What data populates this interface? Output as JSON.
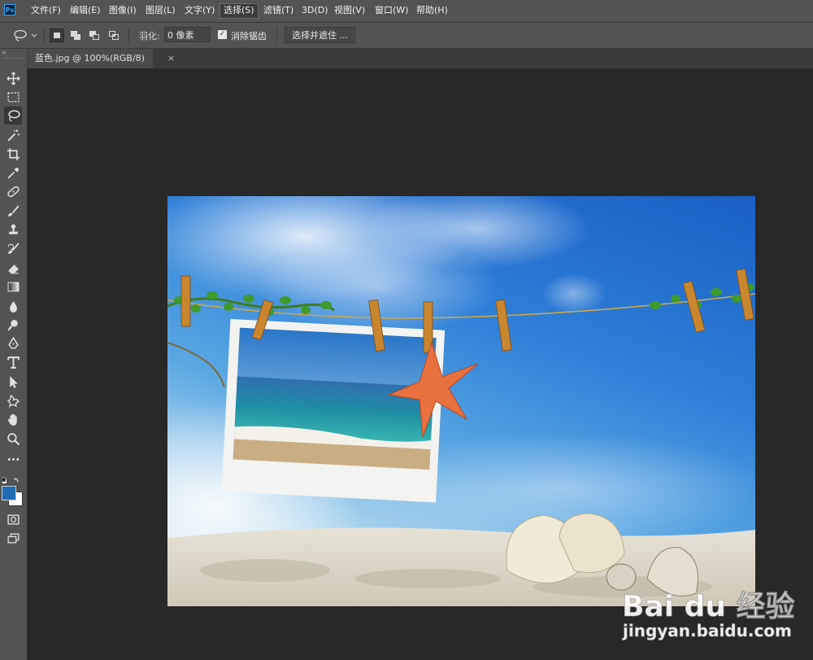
{
  "app": {
    "logo": "Ps",
    "brand_color": "#31a8ff"
  },
  "menu": [
    {
      "label": "文件(F)"
    },
    {
      "label": "编辑(E)"
    },
    {
      "label": "图像(I)"
    },
    {
      "label": "图层(L)"
    },
    {
      "label": "文字(Y)"
    },
    {
      "label": "选择(S)"
    },
    {
      "label": "滤镜(T)"
    },
    {
      "label": "3D(D)"
    },
    {
      "label": "视图(V)"
    },
    {
      "label": "窗口(W)"
    },
    {
      "label": "帮助(H)"
    }
  ],
  "options": {
    "tool_icon": "lasso-icon",
    "selection_modes": [
      "new-selection",
      "add-to-selection",
      "subtract-from-selection",
      "intersect-with-selection"
    ],
    "feather_label": "羽化:",
    "feather_value": "0 像素",
    "antialias_label": "消除锯齿",
    "antialias_checked": true,
    "select_and_mask_label": "选择并遮住 ..."
  },
  "document": {
    "tab_title": "蓝色.jpg @ 100%(RGB/8)",
    "close_glyph": "×"
  },
  "toolbar": {
    "collapse_glyph": "››",
    "tools": [
      "move-tool",
      "rectangular-marquee-tool",
      "lasso-tool",
      "magic-wand-tool",
      "crop-tool",
      "eyedropper-tool",
      "healing-brush-tool",
      "brush-tool",
      "clone-stamp-tool",
      "history-brush-tool",
      "eraser-tool",
      "gradient-tool",
      "blur-tool",
      "dodge-tool",
      "pen-tool",
      "type-tool",
      "path-selection-tool",
      "custom-shape-tool",
      "hand-tool",
      "zoom-tool",
      "edit-toolbar"
    ],
    "active_tool": "lasso-tool",
    "foreground_color": "#1f6bb4",
    "background_color": "#ffffff"
  },
  "watermark": {
    "brand": "Bai du 经验",
    "url": "jingyan.baidu.com"
  }
}
